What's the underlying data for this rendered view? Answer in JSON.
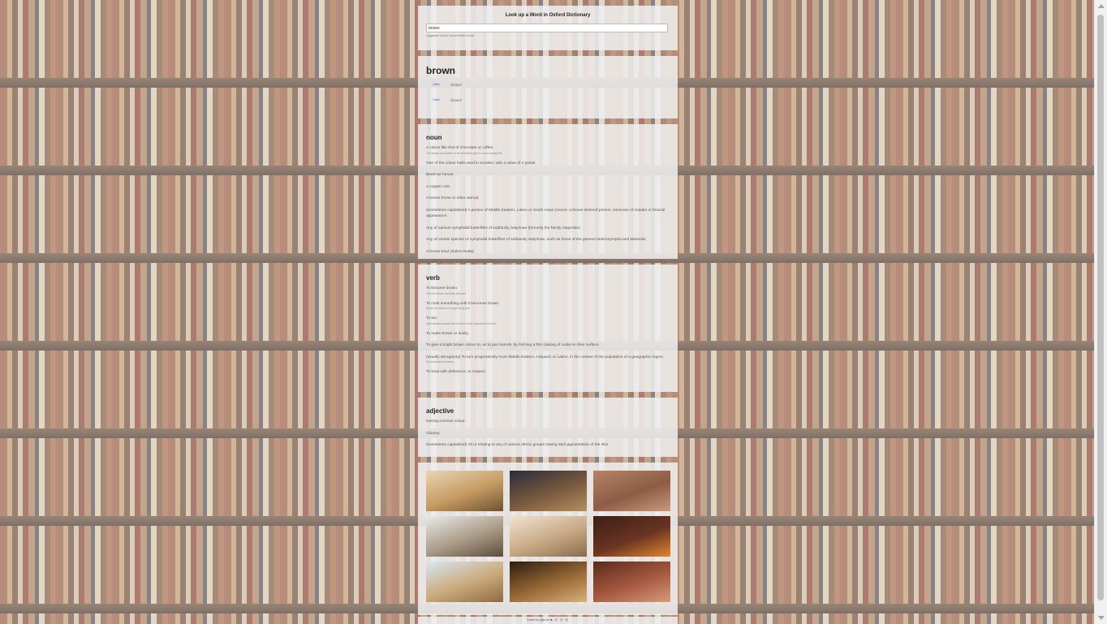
{
  "header": {
    "title": "Look up a Word in Oxford Dictionary"
  },
  "search": {
    "value": "brown",
    "placeholder": "",
    "suggested": "suggested words: sunset,flower,ocean"
  },
  "word": {
    "title": "brown",
    "phonetics": [
      {
        "listen": "Listen",
        "text": "/braʊn/"
      },
      {
        "listen": "Listen",
        "text": "/braʊn/"
      }
    ]
  },
  "noun": {
    "title": "noun",
    "definitions": [
      {
        "text": "A colour like that of chocolate or coffee.",
        "example": "The browns and greens of the woodland give it a cosy-looking feel."
      },
      {
        "text": "One of the colour balls used in snooker, with a value of 4 points.",
        "example": ""
      },
      {
        "text": "Black tar heroin.",
        "example": ""
      },
      {
        "text": "A copper coin.",
        "example": ""
      },
      {
        "text": "A brown horse or other animal.",
        "example": ""
      },
      {
        "text": "(sometimes capitalized) A person of Middle Eastern, Latino or South Asian (recent: a brown-skinned person; someone of mulatto or biracial appearance.",
        "example": ""
      },
      {
        "text": "Any of various nymphalid butterflies of subfamily Satyrinae (formerly the family Satyridae).",
        "example": ""
      },
      {
        "text": "Any of certain species of nymphalid butterflies of subfamily Satyrinae, such as those of the genera Heteronympha and Melanitis.",
        "example": ""
      },
      {
        "text": "A brown trout (Salmo trutta).",
        "example": ""
      }
    ]
  },
  "verb": {
    "title": "verb",
    "definitions": [
      {
        "text": "To become brown.",
        "example": "The tree leaves and fruits browned."
      },
      {
        "text": "To cook something until it becomes brown.",
        "example": "Brown the onions in a large frying pan."
      },
      {
        "text": "To tan.",
        "example": "Light skinned people tend to brown when exposed to the sun."
      },
      {
        "text": "To make brown or dusky.",
        "example": ""
      },
      {
        "text": "To give a bright brown colour to, as to gun barrels, by forming a thin coating of oxide on their surface.",
        "example": ""
      },
      {
        "text": "(usually derogatory) To turn progressively more Middle Eastern, Hispanic or Latino, in the context of the population of a geographic region.",
        "example": "the browning of America"
      },
      {
        "text": "To treat with deference; or respect.",
        "example": ""
      }
    ]
  },
  "adjective": {
    "title": "adjective",
    "definitions": [
      {
        "text": "Having a brown colour.",
        "example": ""
      },
      {
        "text": "Gloomy.",
        "example": ""
      },
      {
        "text": "(sometimes capitalized) Of or relating to any of various ethnic groups having dark pigmentation of the skin.",
        "example": ""
      }
    ]
  },
  "gallery": {
    "photos": [
      {
        "name": "photo-hills-sunset",
        "colors": [
          "#e8d6b6",
          "#c59a62",
          "#6d5134"
        ]
      },
      {
        "name": "photo-dark-leaves",
        "colors": [
          "#2a2c3a",
          "#7a5a3e",
          "#b58e60"
        ]
      },
      {
        "name": "photo-wood-texture",
        "colors": [
          "#b58467",
          "#8e5b44",
          "#c79a80"
        ]
      },
      {
        "name": "photo-dry-grass",
        "colors": [
          "#eaeaea",
          "#a99a86",
          "#5d4c3b"
        ]
      },
      {
        "name": "photo-feather",
        "colors": [
          "#f0e4cf",
          "#c7a885",
          "#8a6a4c"
        ]
      },
      {
        "name": "photo-lantern",
        "colors": [
          "#3c1e14",
          "#6a3422",
          "#e2852e"
        ]
      },
      {
        "name": "photo-pampas-grass",
        "colors": [
          "#d8e6f0",
          "#c9a97a",
          "#8e6a43"
        ]
      },
      {
        "name": "photo-old-buildings",
        "colors": [
          "#2c1c10",
          "#9a6a36",
          "#d8b07a"
        ]
      },
      {
        "name": "photo-silk-fabric",
        "colors": [
          "#5a2a1c",
          "#a65a40",
          "#d79a7c"
        ]
      }
    ]
  },
  "footer": {
    "text": "Coded by @jjs cfx",
    "icons": "♣ ⓒ ⓞ ▣"
  },
  "colors": {
    "card_bg": "#f0f0f0",
    "link": "#3a5fe0"
  }
}
